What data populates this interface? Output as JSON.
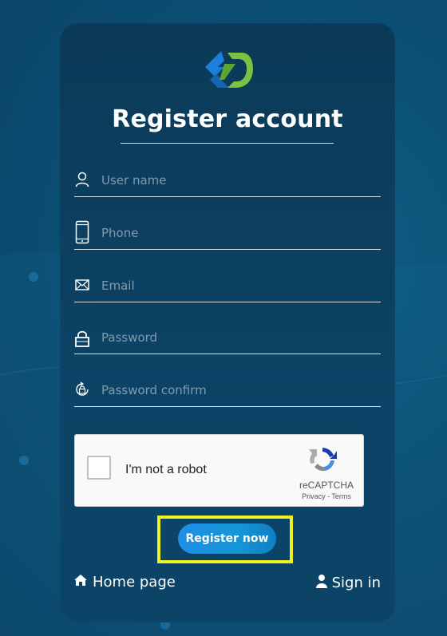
{
  "form": {
    "title": "Register account",
    "fields": [
      {
        "name": "username",
        "icon": "user-icon",
        "placeholder": "User name"
      },
      {
        "name": "phone",
        "icon": "phone-icon",
        "placeholder": "Phone"
      },
      {
        "name": "email",
        "icon": "envelope-icon",
        "placeholder": "Email"
      },
      {
        "name": "password",
        "icon": "lock-icon",
        "placeholder": "Password"
      },
      {
        "name": "password_confirm",
        "icon": "lock-rotate-icon",
        "placeholder": "Password confirm"
      }
    ],
    "captcha": {
      "label": "I'm not a robot",
      "brand": "reCAPTCHA",
      "links": "Privacy - Terms"
    },
    "submit_label": "Register now"
  },
  "footer": {
    "home_label": "Home page",
    "signin_label": "Sign in"
  },
  "colors": {
    "background": "#0b4d72",
    "card": "#0b3a58",
    "button": "#1596d8",
    "highlight": "#f2ef1e"
  }
}
